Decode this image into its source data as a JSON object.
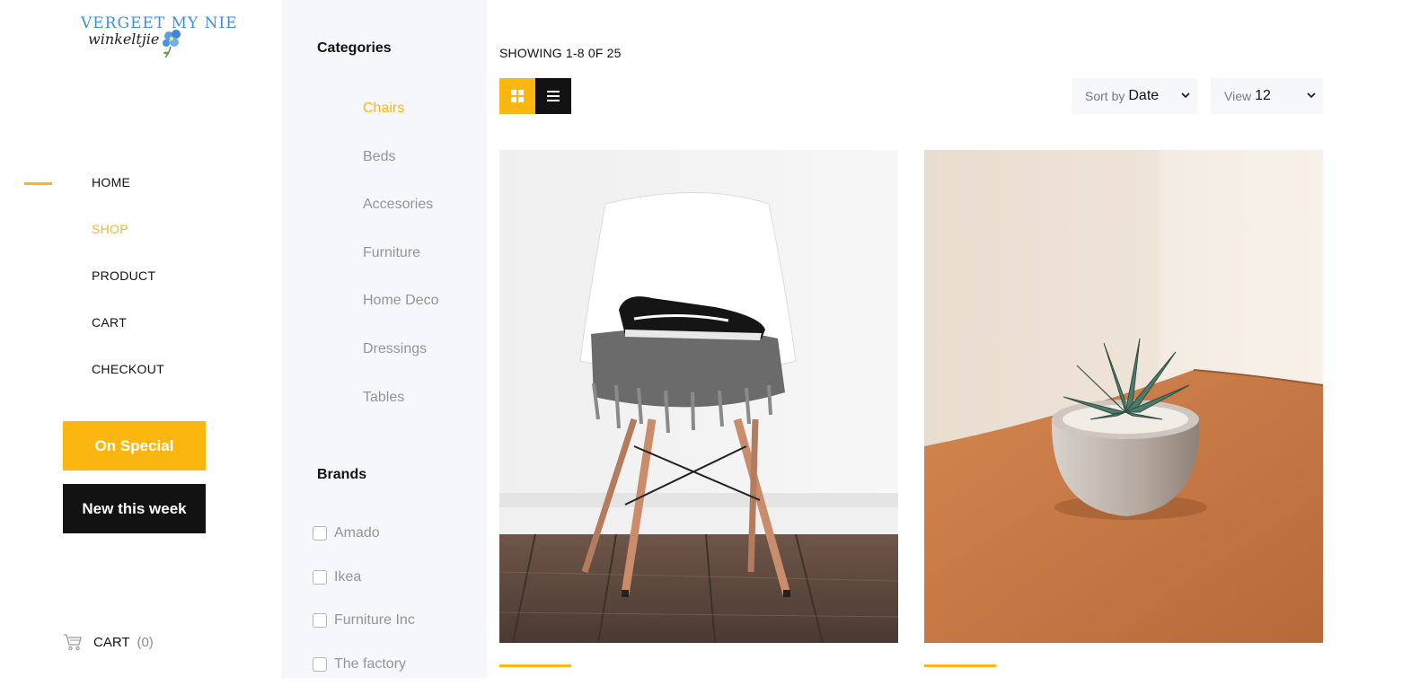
{
  "logo": {
    "line1": "VERGEET MY NIE",
    "line2": "winkeltjie"
  },
  "nav": [
    {
      "label": "HOME"
    },
    {
      "label": "SHOP"
    },
    {
      "label": "PRODUCT"
    },
    {
      "label": "CART"
    },
    {
      "label": "CHECKOUT"
    }
  ],
  "nav_active": "SHOP",
  "buttons": {
    "special": "On Special",
    "new_week": "New this week"
  },
  "cart": {
    "label": "CART",
    "count": "(0)"
  },
  "sidebar": {
    "categories_title": "Categories",
    "categories": [
      "Chairs",
      "Beds",
      "Accesories",
      "Furniture",
      "Home Deco",
      "Dressings",
      "Tables"
    ],
    "active_category": "Chairs",
    "brands_title": "Brands",
    "brands": [
      "Amado",
      "Ikea",
      "Furniture Inc",
      "The factory"
    ]
  },
  "toolbar": {
    "showing": "SHOWING 1-8 0F 25",
    "sort_label": "Sort by",
    "sort_value": "Date",
    "view_label": "View",
    "view_value": "12"
  },
  "products": [
    {
      "image": "white-chair-with-sneakers"
    },
    {
      "image": "succulent-in-pot-on-wood-table"
    }
  ],
  "colors": {
    "accent": "#fbb710",
    "dark": "#131212",
    "muted": "#959595",
    "panel": "#f5f7fa"
  }
}
